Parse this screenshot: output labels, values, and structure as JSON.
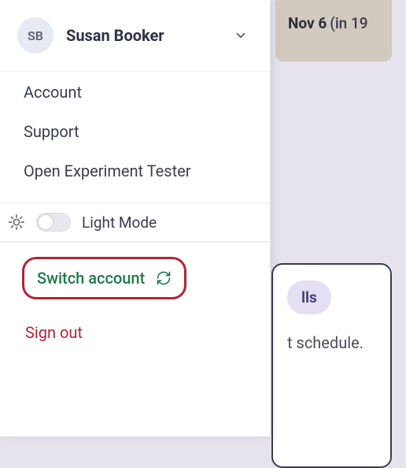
{
  "background": {
    "date_strong": "Nov 6",
    "date_paren": "(in 19",
    "card_tag_suffix": "lls",
    "card_text_suffix": "t schedule."
  },
  "profile": {
    "initials": "SB",
    "name": "Susan Booker"
  },
  "menu": {
    "account": "Account",
    "support": "Support",
    "experiment": "Open Experiment Tester"
  },
  "theme": {
    "label": "Light Mode"
  },
  "actions": {
    "switch": "Switch account",
    "signout": "Sign out"
  }
}
